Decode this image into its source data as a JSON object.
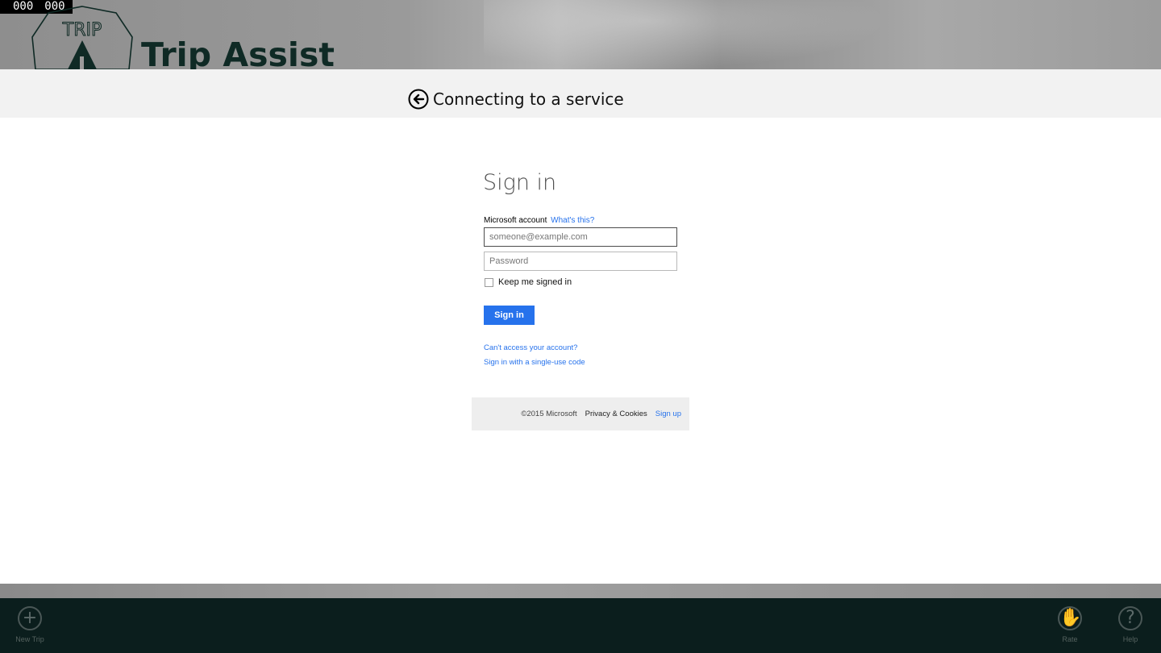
{
  "app": {
    "counter_left": "000",
    "counter_right": "000",
    "logo_text": "TRIP",
    "title": "Trip Assist"
  },
  "auth": {
    "header_title": "Connecting to a service",
    "heading": "Sign in",
    "account_label": "Microsoft account",
    "whats_this": "What's this?",
    "email_placeholder": "someone@example.com",
    "email_value": "",
    "password_placeholder": "Password",
    "keep_signed_in": "Keep me signed in",
    "keep_signed_in_checked": false,
    "signin_button": "Sign in",
    "cant_access": "Can't access your account?",
    "single_use_code": "Sign in with a single-use code",
    "footer": {
      "copyright": "©2015 Microsoft",
      "privacy": "Privacy & Cookies",
      "signup": "Sign up"
    },
    "accent_color": "#2672ec"
  },
  "appbar": {
    "new_trip": "New Trip",
    "rate": "Rate",
    "help": "Help"
  }
}
